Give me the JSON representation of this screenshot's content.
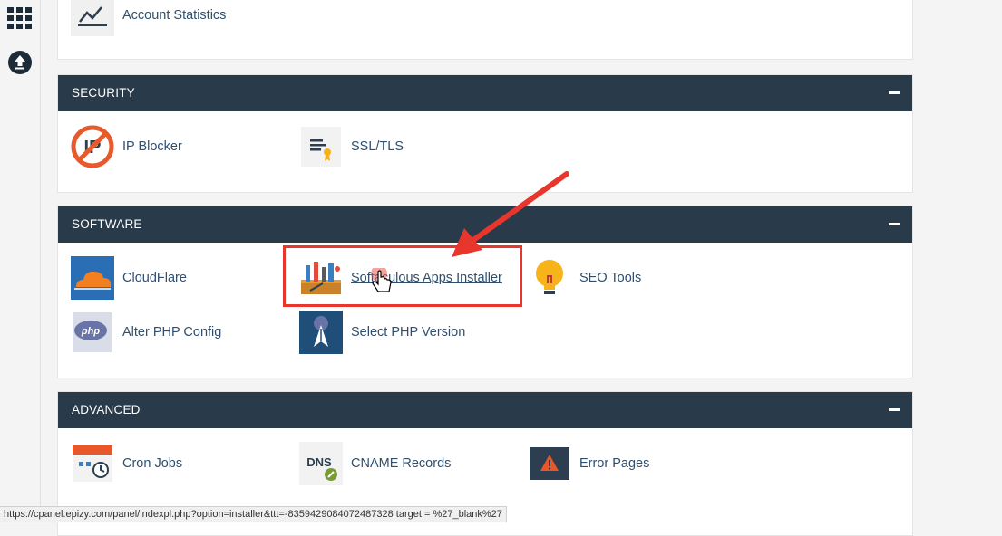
{
  "top_item": {
    "label": "Account Statistics"
  },
  "security": {
    "title": "SECURITY",
    "items": [
      {
        "label": "IP Blocker",
        "icon": "ip-blocker-icon"
      },
      {
        "label": "SSL/TLS",
        "icon": "ssl-certificate-icon"
      }
    ]
  },
  "software": {
    "title": "SOFTWARE",
    "items": [
      {
        "label": "CloudFlare",
        "icon": "cloudflare-icon"
      },
      {
        "label": "Softaculous Apps Installer",
        "icon": "toolbox-icon"
      },
      {
        "label": "SEO Tools",
        "icon": "lightbulb-icon"
      },
      {
        "label": "Alter PHP Config",
        "icon": "php-icon"
      },
      {
        "label": "Select PHP Version",
        "icon": "php-version-icon"
      }
    ]
  },
  "advanced": {
    "title": "ADVANCED",
    "items": [
      {
        "label": "Cron Jobs",
        "icon": "calendar-clock-icon"
      },
      {
        "label": "CNAME Records",
        "icon": "dns-icon"
      },
      {
        "label": "Error Pages",
        "icon": "warning-icon"
      }
    ]
  },
  "icon_text": {
    "php": "php",
    "dns": "DNS",
    "ip": "IP"
  },
  "status_url": "https://cpanel.epizy.com/panel/indexpl.php?option=installer&ttt=-8359429084072487328 target = %27_blank%27",
  "colors": {
    "header_bg": "#293a4a",
    "highlight": "#e8362c",
    "link": "#2f4f6f"
  }
}
